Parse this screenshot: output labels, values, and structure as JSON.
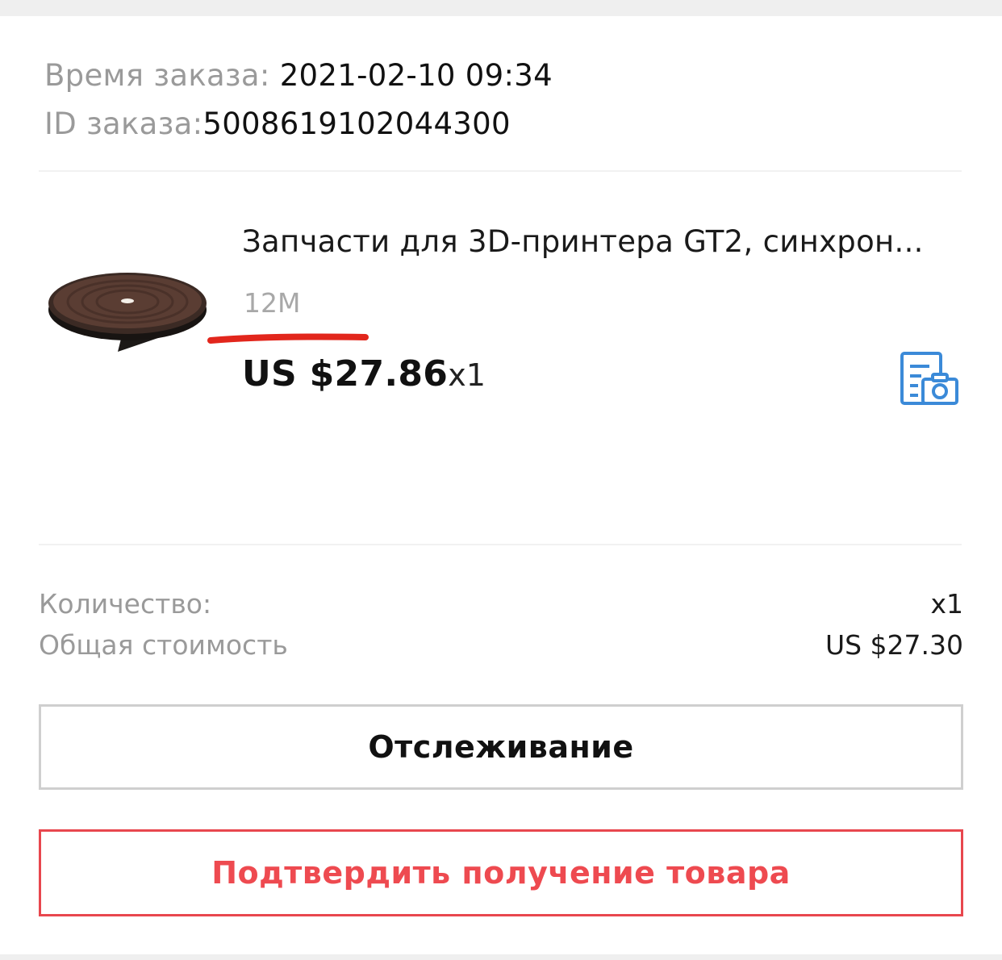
{
  "order": {
    "time_label": "Время заказа: ",
    "time_value": "2021-02-10 09:34",
    "id_label": "ID заказа:",
    "id_value": "5008619102044300"
  },
  "product": {
    "title": "Запчасти для 3D-принтера GT2, синхрон...",
    "variant": "12M",
    "price": "US $27.86",
    "quantity_inline": "x1",
    "snapshot_icon": "order-snapshot-camera-icon",
    "accent_color": "#3b8ad8",
    "annotation_color": "#e2261c"
  },
  "summary": {
    "quantity_label": "Количество:",
    "quantity_value": "x1",
    "total_label": "Общая стоимость",
    "total_value": "US $27.30"
  },
  "actions": {
    "track_label": "Отслеживание",
    "confirm_label": "Подтвердить получение товара",
    "confirm_color": "#ee4a50"
  }
}
